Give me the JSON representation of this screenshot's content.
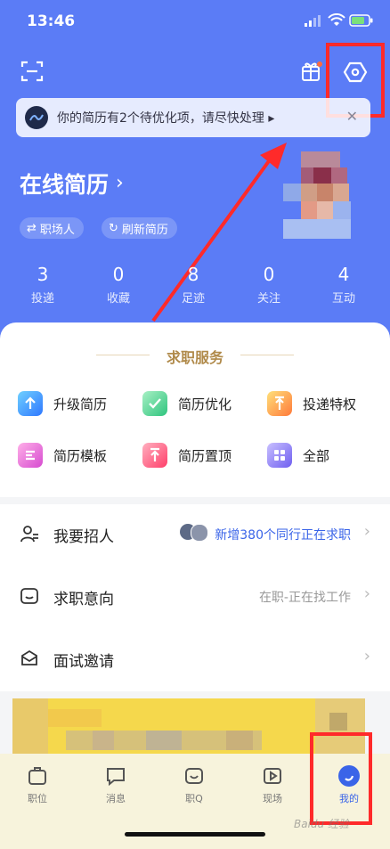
{
  "status": {
    "time": "13:46"
  },
  "notice": {
    "text": "你的简历有2个待优化项，请尽快处理 ▸",
    "close": "✕"
  },
  "resume": {
    "title": "在线简历",
    "chevron": "›",
    "tags": [
      "职场人",
      "刷新简历"
    ]
  },
  "stats": [
    {
      "value": "3",
      "label": "投递"
    },
    {
      "value": "0",
      "label": "收藏"
    },
    {
      "value": "8",
      "label": "足迹"
    },
    {
      "value": "0",
      "label": "关注"
    },
    {
      "value": "4",
      "label": "互动"
    }
  ],
  "services": {
    "title": "求职服务",
    "items": [
      {
        "label": "升级简历",
        "color": "#3aa0ff",
        "icon": "upgrade-resume-icon"
      },
      {
        "label": "简历优化",
        "color": "#3ccf8e",
        "icon": "resume-optimize-icon"
      },
      {
        "label": "投递特权",
        "color": "#ffb23a",
        "icon": "delivery-privilege-icon"
      },
      {
        "label": "简历模板",
        "color": "#f26bd0",
        "icon": "resume-template-icon"
      },
      {
        "label": "简历置顶",
        "color": "#ff5f7a",
        "icon": "resume-top-icon"
      },
      {
        "label": "全部",
        "color": "#8a7cf4",
        "icon": "all-services-icon"
      }
    ]
  },
  "menu": {
    "recruit": {
      "label": "我要招人",
      "value": "新增380个同行正在求职"
    },
    "intention": {
      "label": "求职意向",
      "value": "在职-正在找工作"
    },
    "interview": {
      "label": "面试邀请"
    }
  },
  "tabs": [
    {
      "label": "职位",
      "icon": "jobs-icon"
    },
    {
      "label": "消息",
      "icon": "messages-icon"
    },
    {
      "label": "职Q",
      "icon": "job-q-icon"
    },
    {
      "label": "现场",
      "icon": "live-icon"
    },
    {
      "label": "我的",
      "icon": "profile-icon"
    }
  ],
  "watermark": "Baidu 经验",
  "colors": {
    "hero": "#5b7cf6",
    "accent": "#3a64e8",
    "highlight": "#ff2a2a",
    "gold": "#b08a4a"
  }
}
